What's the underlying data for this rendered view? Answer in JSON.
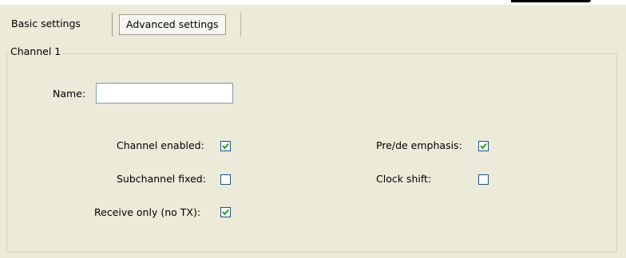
{
  "tabs": {
    "basic_label": "Basic settings",
    "advanced_label": "Advanced settings",
    "active": "Advanced settings"
  },
  "group": {
    "legend": "Channel 1"
  },
  "fields": {
    "name_label": "Name:",
    "name_value": ""
  },
  "checkboxes": {
    "channel_enabled": {
      "label": "Channel enabled:",
      "checked": true
    },
    "subchannel_fixed": {
      "label": "Subchannel fixed:",
      "checked": false
    },
    "receive_only": {
      "label": "Receive only (no TX):",
      "checked": true
    },
    "pre_de_emphasis": {
      "label": "Pre/de emphasis:",
      "checked": true
    },
    "clock_shift": {
      "label": "Clock shift:",
      "checked": false
    }
  },
  "colors": {
    "background": "#ecead9",
    "checkbox_border": "#1c5180",
    "checkmark": "#21a121"
  },
  "icons": {
    "checkmark": "checkmark-icon"
  }
}
